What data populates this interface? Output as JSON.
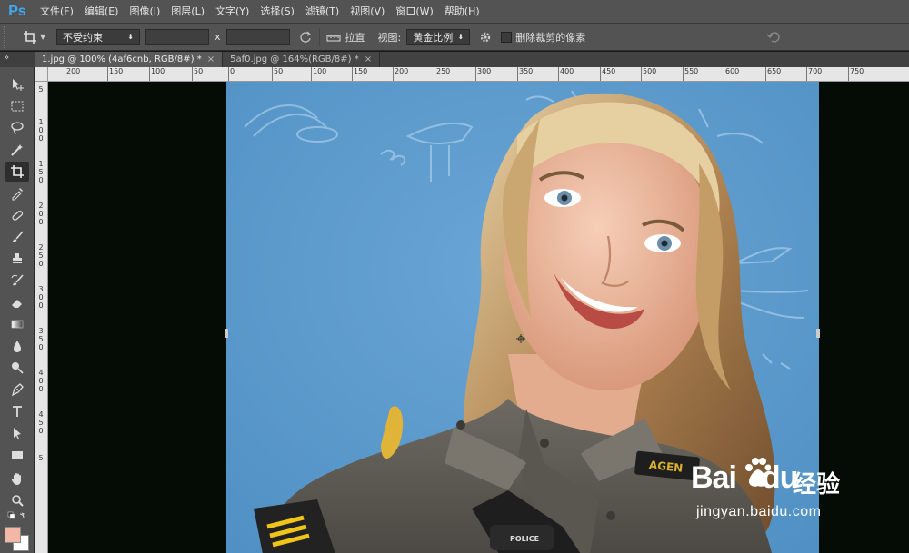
{
  "app": {
    "logo": "Ps"
  },
  "menu": [
    {
      "label": "文件(F)"
    },
    {
      "label": "编辑(E)"
    },
    {
      "label": "图像(I)"
    },
    {
      "label": "图层(L)"
    },
    {
      "label": "文字(Y)"
    },
    {
      "label": "选择(S)"
    },
    {
      "label": "滤镜(T)"
    },
    {
      "label": "视图(V)"
    },
    {
      "label": "窗口(W)"
    },
    {
      "label": "帮助(H)"
    }
  ],
  "options": {
    "ratio_select": "不受约束",
    "x_sep": "x",
    "straighten_label": "拉直",
    "view_label": "视图:",
    "view_select": "黄金比例",
    "delete_cropped_label": "删除裁剪的像素"
  },
  "tabs": [
    {
      "label": "1.jpg @ 100% (4af6cnb, RGB/8#) *",
      "active": true
    },
    {
      "label": "5af0.jpg @ 164%(RGB/8#) *",
      "active": false
    }
  ],
  "ruler": {
    "top": [
      "200",
      "150",
      "100",
      "50",
      "0",
      "50",
      "100",
      "150",
      "200",
      "250",
      "300",
      "350",
      "400",
      "450",
      "500",
      "550",
      "600",
      "650",
      "700",
      "750"
    ],
    "left": [
      "5",
      "1 0 0",
      "1 5 0",
      "2 0 0",
      "2 5 0",
      "3 0 0",
      "3 5 0",
      "4 0 0",
      "4 5 0",
      "5"
    ]
  },
  "watermark": {
    "brand": "Bai",
    "brand_suffix": "du",
    "cn": "经验",
    "url": "jingyan.baidu.com"
  },
  "colors": {
    "foreground": "#f2b7a5",
    "background": "#ffffff",
    "sky": "#5f9ccd"
  }
}
